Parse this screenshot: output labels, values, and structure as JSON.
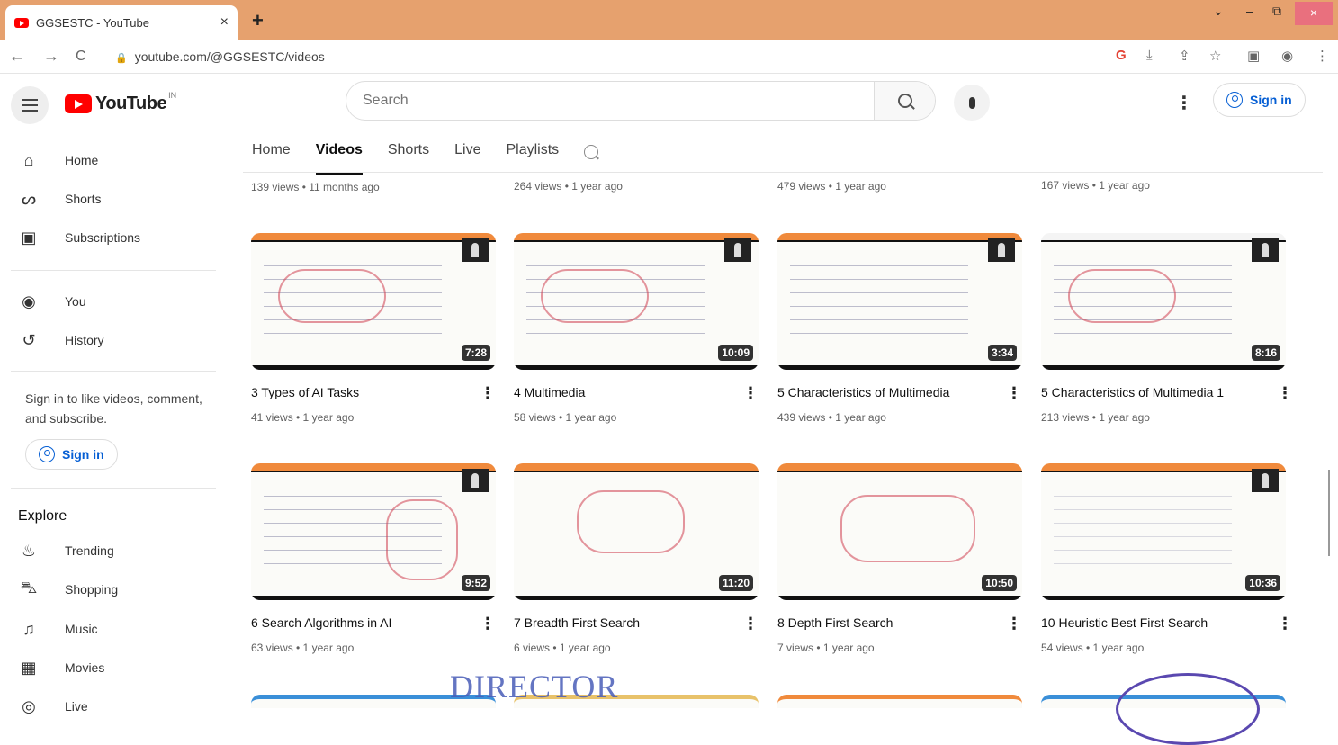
{
  "browser": {
    "tab_title": "GGSESTC - YouTube",
    "close_glyph": "×",
    "new_tab_glyph": "+",
    "url": "youtube.com/@GGSESTC/videos",
    "controls": [
      "⌄",
      "–",
      "⧉",
      "×"
    ],
    "nav_icons": [
      "←",
      "→",
      "C"
    ],
    "ext_icons": [
      "G",
      "⤓",
      "⇪",
      "☆",
      "▣",
      "◉",
      "⋮"
    ]
  },
  "youtube": {
    "logo_text": "YouTube",
    "country": "IN",
    "search_placeholder": "Search",
    "menu_glyph": "⋮",
    "signin_label": "Sign in"
  },
  "sidebar": {
    "items": [
      {
        "label": "Home",
        "icon": "home-icon",
        "glyph": "⌂"
      },
      {
        "label": "Shorts",
        "icon": "shorts-icon",
        "glyph": "ᔕ"
      },
      {
        "label": "Subscriptions",
        "icon": "subscriptions-icon",
        "glyph": "▣"
      },
      {
        "label": "You",
        "icon": "you-icon",
        "glyph": "◉"
      },
      {
        "label": "History",
        "icon": "history-icon",
        "glyph": "↺"
      }
    ],
    "signin_text": "Sign in to like videos, comment, and subscribe.",
    "signin_label": "Sign in",
    "explore_label": "Explore",
    "explore_items": [
      {
        "label": "Trending",
        "icon": "trending-icon",
        "glyph": "♨"
      },
      {
        "label": "Shopping",
        "icon": "shopping-icon",
        "glyph": "⛍"
      },
      {
        "label": "Music",
        "icon": "music-icon",
        "glyph": "♫"
      },
      {
        "label": "Movies",
        "icon": "movies-icon",
        "glyph": "▦"
      },
      {
        "label": "Live",
        "icon": "live-icon",
        "glyph": "◎"
      }
    ]
  },
  "channel_tabs": [
    "Home",
    "Videos",
    "Shorts",
    "Live",
    "Playlists"
  ],
  "active_tab": "Videos",
  "top_row_meta": [
    "139 views • 11 months ago",
    "264 views • 1 year ago",
    "479 views • 1 year ago",
    "167 views • 1 year ago"
  ],
  "videos": [
    {
      "title": "3 Types of AI Tasks",
      "meta": "41 views • 1 year ago",
      "duration": "7:28"
    },
    {
      "title": "4 Multimedia",
      "meta": "58 views • 1 year ago",
      "duration": "10:09"
    },
    {
      "title": "5 Characteristics of Multimedia",
      "meta": "439 views • 1 year ago",
      "duration": "3:34"
    },
    {
      "title": "5 Characteristics of Multimedia 1",
      "meta": "213 views • 1 year ago",
      "duration": "8:16"
    },
    {
      "title": "6 Search Algorithms in AI",
      "meta": "63 views • 1 year ago",
      "duration": "9:52"
    },
    {
      "title": "7 Breadth First Search",
      "meta": "6 views • 1 year ago",
      "duration": "11:20"
    },
    {
      "title": "8 Depth First Search",
      "meta": "7 views • 1 year ago",
      "duration": "10:50"
    },
    {
      "title": "10 Heuristic Best First Search",
      "meta": "54 views • 1 year ago",
      "duration": "10:36"
    }
  ],
  "overlay": {
    "stamp_text": "DIRECTOR"
  },
  "colors": {
    "tabbar": "#e6a16e",
    "yt_red": "#ff0000",
    "link_blue": "#065fd4"
  }
}
